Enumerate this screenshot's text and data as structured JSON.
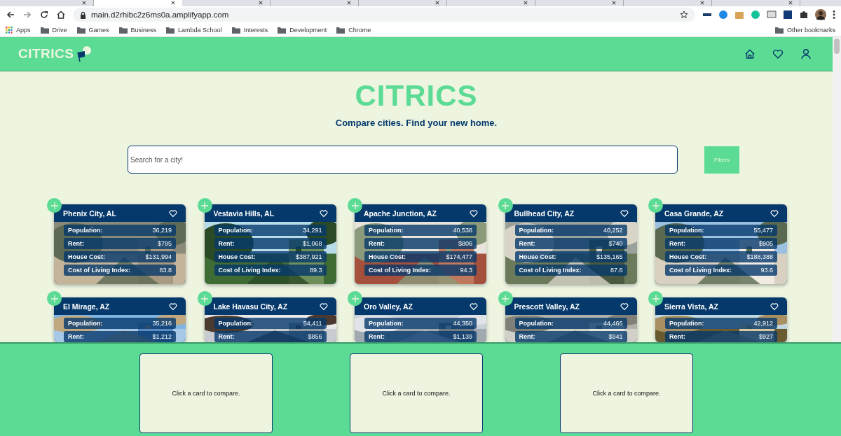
{
  "browser": {
    "tabs": [
      {
        "selected": false
      },
      {
        "selected": true
      },
      {
        "selected": false
      },
      {
        "selected": false
      },
      {
        "selected": false
      },
      {
        "selected": false
      },
      {
        "selected": false
      },
      {
        "selected": false
      },
      {
        "selected": false
      }
    ],
    "url": "main.d2rhibc2z6ms0a.amplifyapp.com",
    "bookmarks": [
      {
        "kind": "apps",
        "label": "Apps"
      },
      {
        "kind": "folder",
        "label": "Drive"
      },
      {
        "kind": "folder",
        "label": "Games"
      },
      {
        "kind": "folder",
        "label": "Business"
      },
      {
        "kind": "folder",
        "label": "Lambda School"
      },
      {
        "kind": "folder",
        "label": "Interests"
      },
      {
        "kind": "folder",
        "label": "Development"
      },
      {
        "kind": "folder",
        "label": "Chrome"
      }
    ],
    "other_bookmarks": "Other bookmarks"
  },
  "site": {
    "logo": "CITRICS",
    "title": "CITRICS",
    "tagline": "Compare cities. Find your new home.",
    "search": {
      "placeholder": "Search for a city!"
    },
    "filters_button": "Filters",
    "cities": [
      {
        "name": "Phenix City, AL",
        "stats": [
          {
            "label": "Population:",
            "value": "36,219"
          },
          {
            "label": "Rent:",
            "value": "$795"
          },
          {
            "label": "House Cost:",
            "value": "$131,994"
          },
          {
            "label": "Cost of Living Index:",
            "value": "83.8"
          }
        ]
      },
      {
        "name": "Vestavia Hills, AL",
        "stats": [
          {
            "label": "Population:",
            "value": "34,291"
          },
          {
            "label": "Rent:",
            "value": "$1,068"
          },
          {
            "label": "House Cost:",
            "value": "$387,921"
          },
          {
            "label": "Cost of Living Index:",
            "value": "89.3"
          }
        ]
      },
      {
        "name": "Apache Junction, AZ",
        "stats": [
          {
            "label": "Population:",
            "value": "40,538"
          },
          {
            "label": "Rent:",
            "value": "$806"
          },
          {
            "label": "House Cost:",
            "value": "$174,477"
          },
          {
            "label": "Cost of Living Index:",
            "value": "94.3"
          }
        ]
      },
      {
        "name": "Bullhead City, AZ",
        "stats": [
          {
            "label": "Population:",
            "value": "40,252"
          },
          {
            "label": "Rent:",
            "value": "$740"
          },
          {
            "label": "House Cost:",
            "value": "$135,165"
          },
          {
            "label": "Cost of Living Index:",
            "value": "87.6"
          }
        ]
      },
      {
        "name": "Casa Grande, AZ",
        "stats": [
          {
            "label": "Population:",
            "value": "55,477"
          },
          {
            "label": "Rent:",
            "value": "$905"
          },
          {
            "label": "House Cost:",
            "value": "$188,388"
          },
          {
            "label": "Cost of Living Index:",
            "value": "93.6"
          }
        ]
      },
      {
        "name": "El Mirage, AZ",
        "stats": [
          {
            "label": "Population:",
            "value": "35,216"
          },
          {
            "label": "Rent:",
            "value": "$1,212"
          }
        ]
      },
      {
        "name": "Lake Havasu City, AZ",
        "stats": [
          {
            "label": "Population:",
            "value": "54,411"
          },
          {
            "label": "Rent:",
            "value": "$856"
          }
        ]
      },
      {
        "name": "Oro Valley, AZ",
        "stats": [
          {
            "label": "Population:",
            "value": "44,350"
          },
          {
            "label": "Rent:",
            "value": "$1,139"
          }
        ]
      },
      {
        "name": "Prescott Valley, AZ",
        "stats": [
          {
            "label": "Population:",
            "value": "44,466"
          },
          {
            "label": "Rent:",
            "value": "$941"
          }
        ]
      },
      {
        "name": "Sierra Vista, AZ",
        "stats": [
          {
            "label": "Population:",
            "value": "42,912"
          },
          {
            "label": "Rent:",
            "value": "$927"
          }
        ]
      }
    ],
    "compare_slots": [
      "Click a card to compare.",
      "Click a card to compare.",
      "Click a card to compare."
    ]
  }
}
